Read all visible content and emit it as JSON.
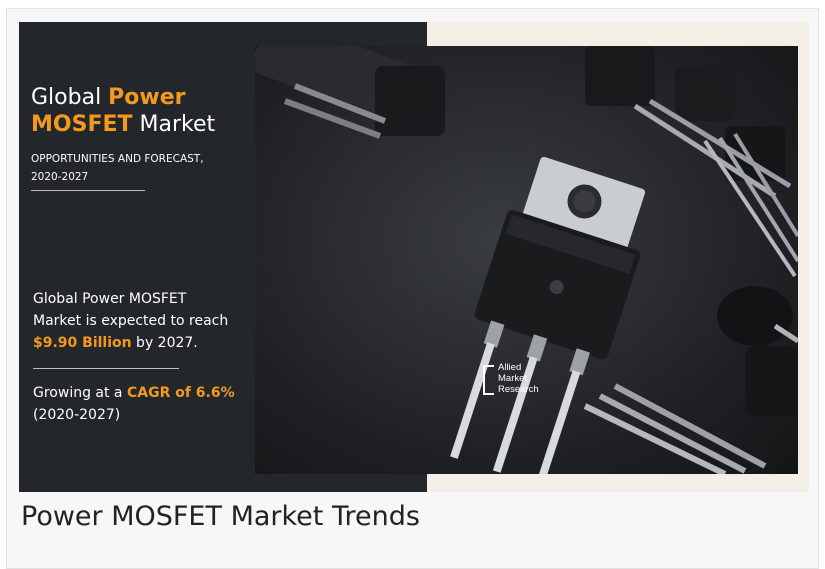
{
  "headline": {
    "part1": "Global ",
    "part2": "Power",
    "part3": "MOSFET",
    "part4": " Market"
  },
  "subhead": {
    "line1": "OPPORTUNITIES AND FORECAST,",
    "line2": "2020-2027"
  },
  "fact1": {
    "line1": "Global Power MOSFET",
    "line2": "Market is expected to reach",
    "value": "$9.90 Billion",
    "line3_rest": " by 2027."
  },
  "fact2": {
    "prefix": "Growing at a ",
    "cagr": "CAGR of 6.6%",
    "period": "(2020-2027)"
  },
  "logo": {
    "line1": "Allied",
    "line2": "Market",
    "line3": "Research"
  },
  "caption": "Power MOSFET Market Trends",
  "colors": {
    "accent": "#f39a1e",
    "panel": "#23272b"
  }
}
